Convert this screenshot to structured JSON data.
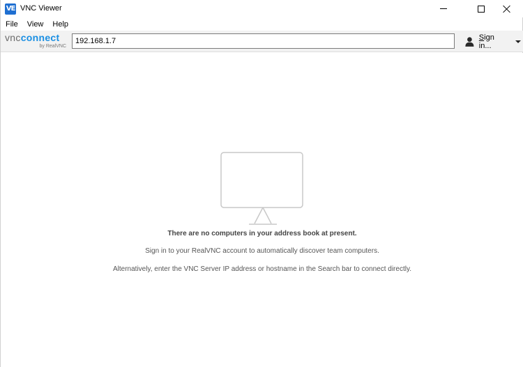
{
  "window": {
    "title": "VNC Viewer",
    "icon": "vnc-viewer-app-icon",
    "icon_text": "VE"
  },
  "menu": {
    "items": [
      "File",
      "View",
      "Help"
    ]
  },
  "toolbar": {
    "logo_vnc": "vnc",
    "logo_connect": "connect",
    "logo_sub": "by RealVNC",
    "search_value": "192.168.1.7",
    "signin_label": "Sign in...",
    "accent_color": "#1a8fe3"
  },
  "empty_state": {
    "icon": "monitor-icon",
    "title": "There are no computers in your address book at present.",
    "line1": "Sign in to your RealVNC account to automatically discover team computers.",
    "line2": "Alternatively, enter the VNC Server IP address or hostname in the Search bar to connect directly."
  }
}
